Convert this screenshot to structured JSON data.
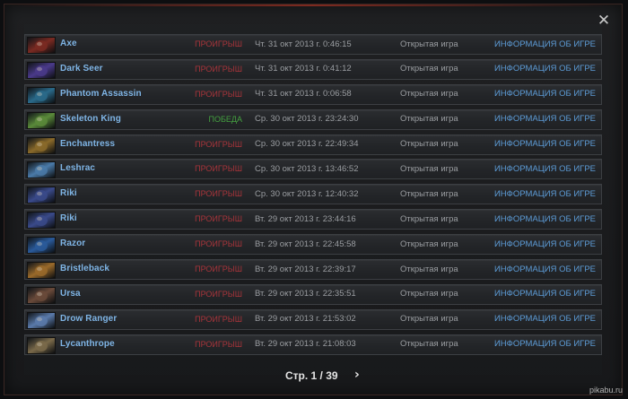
{
  "close_icon": "close-icon",
  "matches": [
    {
      "hero": "Axe",
      "result": "ПРОИГРЫШ",
      "outcome": "loss",
      "date": "Чт. 31 окт 2013 г. 0:46:15",
      "mode": "Открытая игра",
      "info": "ИНФОРМАЦИЯ ОБ ИГРЕ",
      "icon_color": "#7a2a22"
    },
    {
      "hero": "Dark Seer",
      "result": "ПРОИГРЫШ",
      "outcome": "loss",
      "date": "Чт. 31 окт 2013 г. 0:41:12",
      "mode": "Открытая игра",
      "info": "ИНФОРМАЦИЯ ОБ ИГРЕ",
      "icon_color": "#4a3a8a"
    },
    {
      "hero": "Phantom Assassin",
      "result": "ПРОИГРЫШ",
      "outcome": "loss",
      "date": "Чт. 31 окт 2013 г. 0:06:58",
      "mode": "Открытая игра",
      "info": "ИНФОРМАЦИЯ ОБ ИГРЕ",
      "icon_color": "#2a6a8a"
    },
    {
      "hero": "Skeleton King",
      "result": "ПОБЕДА",
      "outcome": "win",
      "date": "Ср. 30 окт 2013 г. 23:24:30",
      "mode": "Открытая игра",
      "info": "ИНФОРМАЦИЯ ОБ ИГРЕ",
      "icon_color": "#5a8a3a"
    },
    {
      "hero": "Enchantress",
      "result": "ПРОИГРЫШ",
      "outcome": "loss",
      "date": "Ср. 30 окт 2013 г. 22:49:34",
      "mode": "Открытая игра",
      "info": "ИНФОРМАЦИЯ ОБ ИГРЕ",
      "icon_color": "#8a6a2a"
    },
    {
      "hero": "Leshrac",
      "result": "ПРОИГРЫШ",
      "outcome": "loss",
      "date": "Ср. 30 окт 2013 г. 13:46:52",
      "mode": "Открытая игра",
      "info": "ИНФОРМАЦИЯ ОБ ИГРЕ",
      "icon_color": "#4a7aa8"
    },
    {
      "hero": "Riki",
      "result": "ПРОИГРЫШ",
      "outcome": "loss",
      "date": "Ср. 30 окт 2013 г. 12:40:32",
      "mode": "Открытая игра",
      "info": "ИНФОРМАЦИЯ ОБ ИГРЕ",
      "icon_color": "#3a4a8a"
    },
    {
      "hero": "Riki",
      "result": "ПРОИГРЫШ",
      "outcome": "loss",
      "date": "Вт. 29 окт 2013 г. 23:44:16",
      "mode": "Открытая игра",
      "info": "ИНФОРМАЦИЯ ОБ ИГРЕ",
      "icon_color": "#3a4a8a"
    },
    {
      "hero": "Razor",
      "result": "ПРОИГРЫШ",
      "outcome": "loss",
      "date": "Вт. 29 окт 2013 г. 22:45:58",
      "mode": "Открытая игра",
      "info": "ИНФОРМАЦИЯ ОБ ИГРЕ",
      "icon_color": "#2a5a9a"
    },
    {
      "hero": "Bristleback",
      "result": "ПРОИГРЫШ",
      "outcome": "loss",
      "date": "Вт. 29 окт 2013 г. 22:39:17",
      "mode": "Открытая игра",
      "info": "ИНФОРМАЦИЯ ОБ ИГРЕ",
      "icon_color": "#9a6a2a"
    },
    {
      "hero": "Ursa",
      "result": "ПРОИГРЫШ",
      "outcome": "loss",
      "date": "Вт. 29 окт 2013 г. 22:35:51",
      "mode": "Открытая игра",
      "info": "ИНФОРМАЦИЯ ОБ ИГРЕ",
      "icon_color": "#6a4a3a"
    },
    {
      "hero": "Drow Ranger",
      "result": "ПРОИГРЫШ",
      "outcome": "loss",
      "date": "Вт. 29 окт 2013 г. 21:53:02",
      "mode": "Открытая игра",
      "info": "ИНФОРМАЦИЯ ОБ ИГРЕ",
      "icon_color": "#5a7aaa"
    },
    {
      "hero": "Lycanthrope",
      "result": "ПРОИГРЫШ",
      "outcome": "loss",
      "date": "Вт. 29 окт 2013 г. 21:08:03",
      "mode": "Открытая игра",
      "info": "ИНФОРМАЦИЯ ОБ ИГРЕ",
      "icon_color": "#7a6a4a"
    }
  ],
  "pagination": {
    "label": "Стр. 1 / 39",
    "next_icon": "chevron-right-icon"
  },
  "watermark": "pikabu.ru",
  "colors": {
    "loss": "#a8343a",
    "win": "#44a140",
    "hero_name": "#7fb5e6",
    "info_link": "#5c9bd6"
  }
}
